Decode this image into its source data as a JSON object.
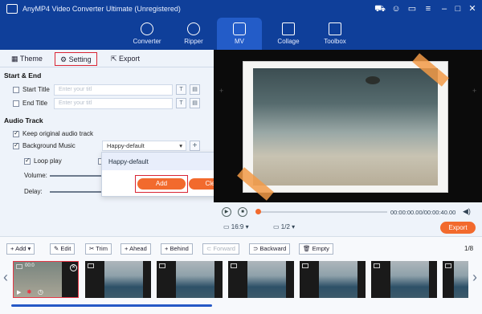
{
  "app": {
    "title": "AnyMP4 Video Converter Ultimate (Unregistered)",
    "accent_color": "#f26a2d",
    "brand_color": "#0f3f9a",
    "titlebar_icons": [
      "cart-icon",
      "user-icon",
      "chat-icon",
      "menu-icon",
      "minimize-icon",
      "maximize-icon",
      "close-icon"
    ]
  },
  "nav": {
    "items": [
      {
        "label": "Converter",
        "icon": "converter-icon"
      },
      {
        "label": "Ripper",
        "icon": "ripper-icon"
      },
      {
        "label": "MV",
        "icon": "mv-icon",
        "active": true
      },
      {
        "label": "Collage",
        "icon": "collage-icon"
      },
      {
        "label": "Toolbox",
        "icon": "toolbox-icon"
      }
    ]
  },
  "tabs": {
    "theme": "Theme",
    "setting": "Setting",
    "export": "Export",
    "active": "Setting"
  },
  "start_end": {
    "heading": "Start & End",
    "start_title_label": "Start Title",
    "start_title_placeholder": "Enter your titl",
    "end_title_label": "End Title",
    "end_title_placeholder": "Enter your titl"
  },
  "audio": {
    "heading": "Audio Track",
    "keep_original_label": "Keep original audio track",
    "keep_original_checked": true,
    "bg_music_label": "Background Music",
    "bg_music_checked": true,
    "bg_music_value": "Happy-default",
    "loop_label": "Loop play",
    "loop_checked": true,
    "volume_label": "Volume:",
    "delay_label": "Delay:"
  },
  "popup": {
    "item": "Happy-default",
    "add_label": "Add",
    "clear_label": "Clear"
  },
  "player": {
    "time": "00:00:00.00/00:00:40.00",
    "aspect": "16:9",
    "scale": "1/2",
    "export_label": "Export"
  },
  "timeline": {
    "add_label": "Add",
    "edit_label": "Edit",
    "trim_label": "Trim",
    "ahead_label": "Ahead",
    "behind_label": "Behind",
    "forward_label": "Forward",
    "backward_label": "Backward",
    "empty_label": "Empty",
    "page": "1/8",
    "first_clip_duration": "00:0"
  }
}
